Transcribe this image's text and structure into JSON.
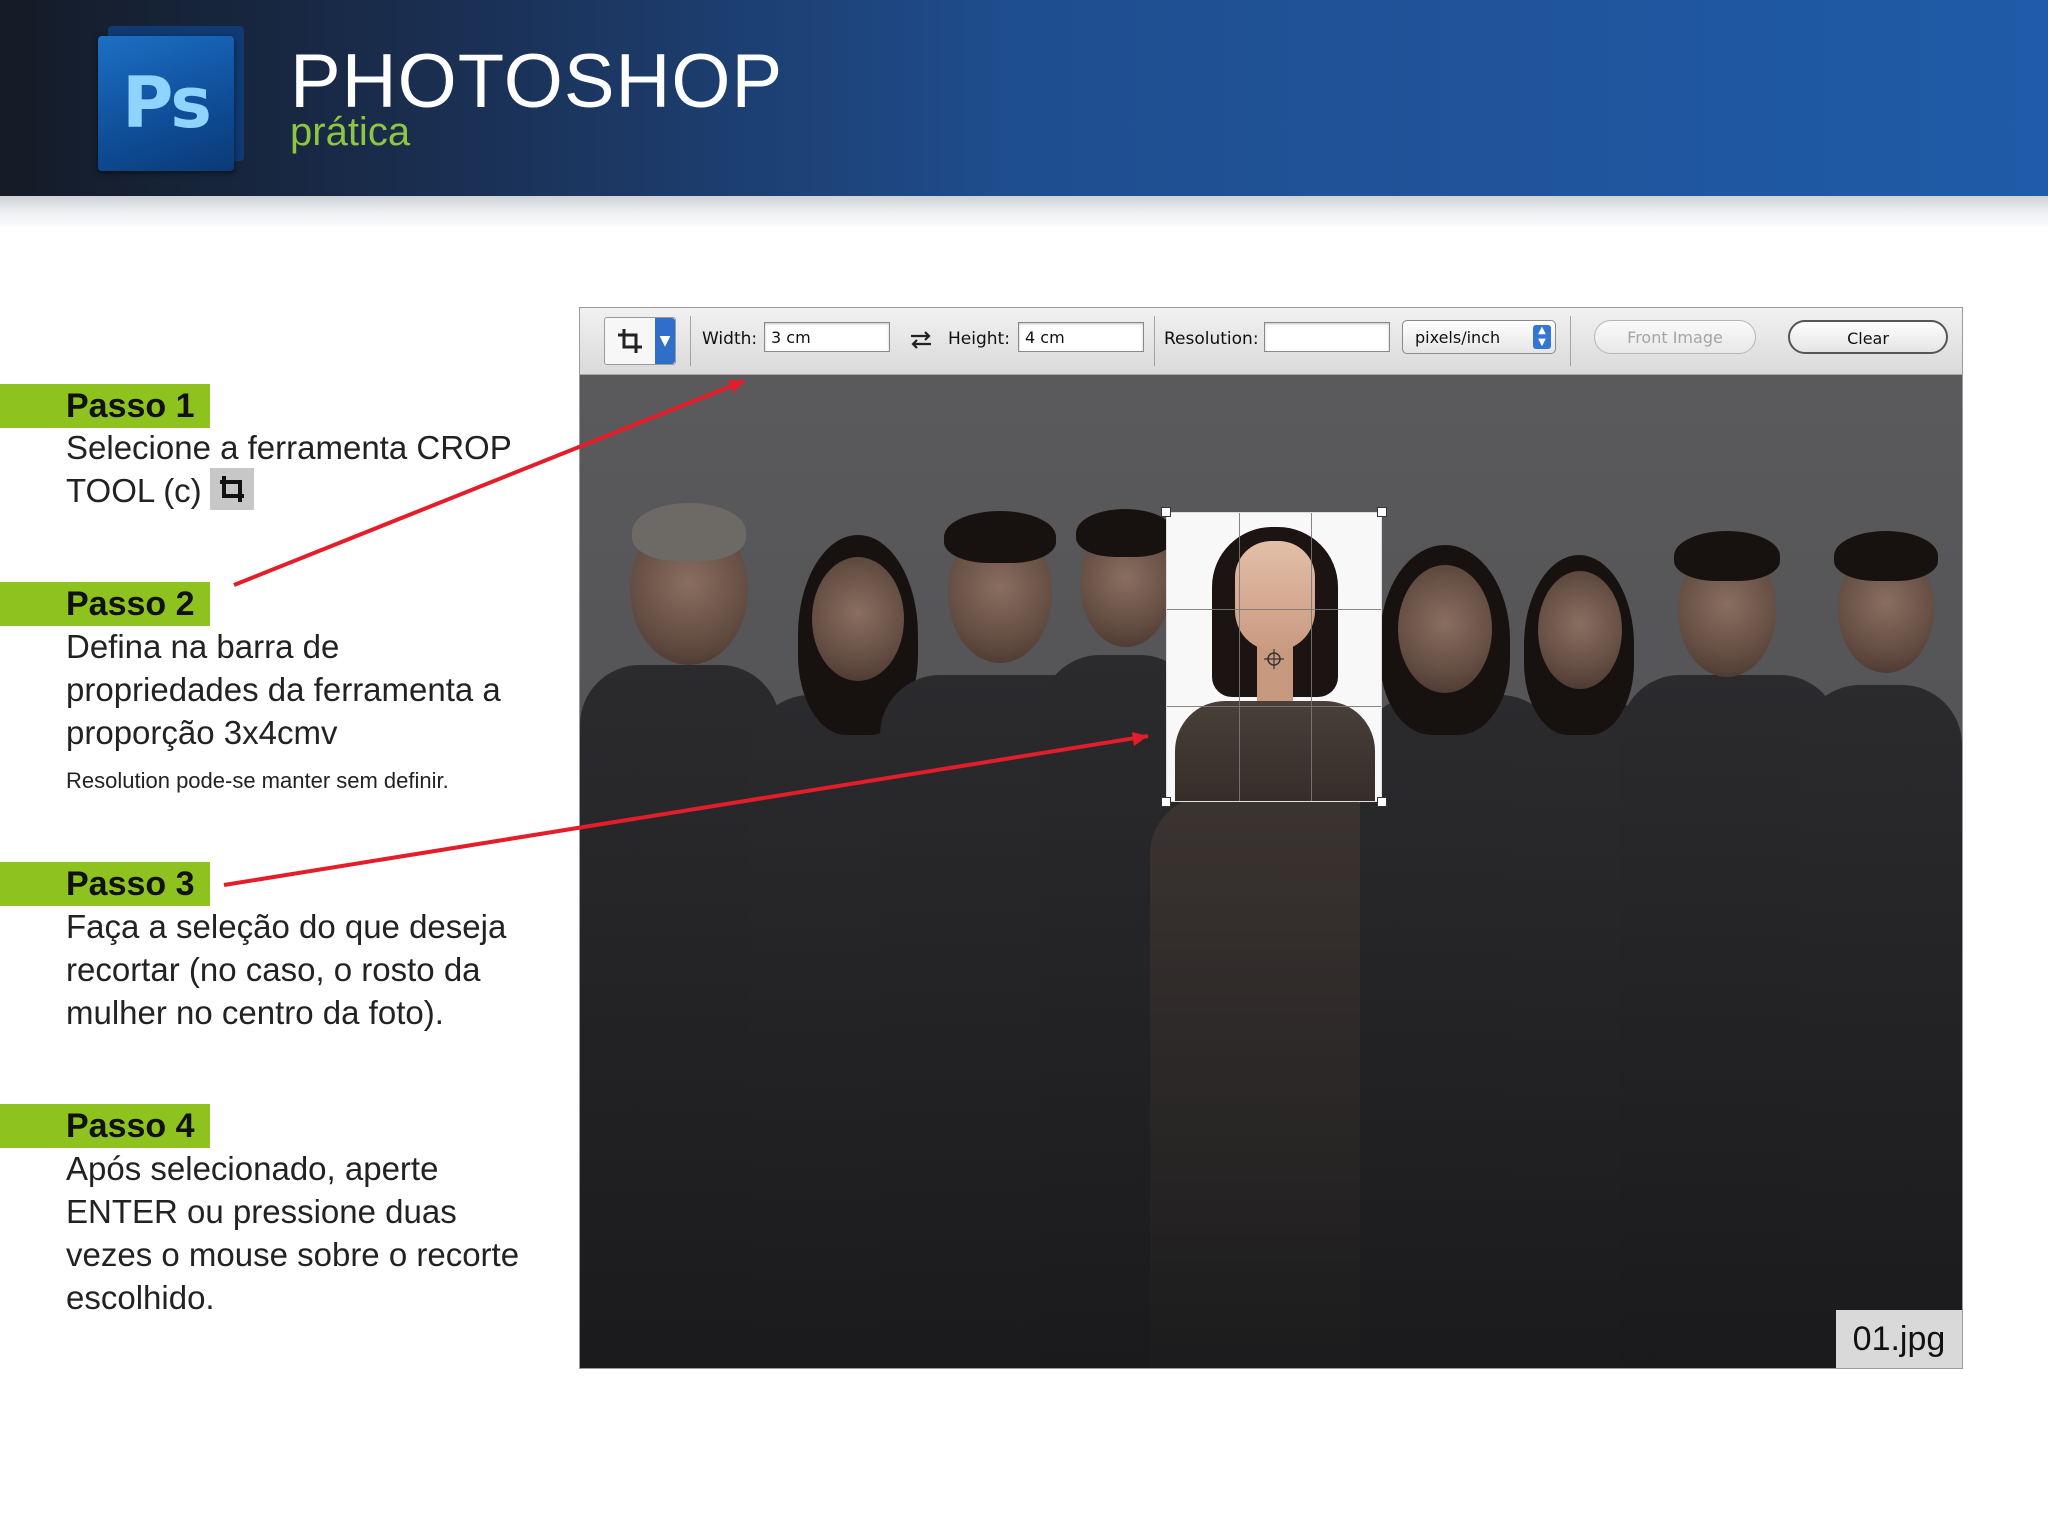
{
  "header": {
    "title": "PHOTOSHOP",
    "subtitle": "prática",
    "logo_text": "Ps"
  },
  "steps": [
    {
      "title": "Passo 1",
      "lines": [
        "Selecione a ferramenta CROP",
        "TOOL (c)"
      ]
    },
    {
      "title": "Passo 2",
      "lines": [
        "Defina na barra de",
        "propriedades da ferramenta a",
        "proporção 3x4cmv"
      ],
      "note": "Resolution pode-se manter sem definir."
    },
    {
      "title": "Passo 3",
      "lines": [
        "Faça a seleção do que deseja",
        "recortar (no caso, o rosto da",
        "mulher no centro da foto)."
      ]
    },
    {
      "title": "Passo 4",
      "lines": [
        "Após selecionado, aperte",
        "ENTER ou pressione duas",
        "vezes o mouse sobre o recorte",
        "escolhido."
      ]
    }
  ],
  "options_bar": {
    "width_label": "Width:",
    "width_value": "3 cm",
    "height_label": "Height:",
    "height_value": "4 cm",
    "resolution_label": "Resolution:",
    "resolution_value": "",
    "unit_select": "pixels/inch",
    "front_image_label": "Front Image",
    "clear_label": "Clear"
  },
  "canvas": {
    "filename": "01.jpg"
  },
  "colors": {
    "step_green": "#8ec31f",
    "arrow_red": "#e41d2a",
    "header_blue": "#1f5ba8"
  },
  "icons": [
    "crop-tool-icon",
    "swap-arrows-icon",
    "dropdown-arrow-icon"
  ]
}
